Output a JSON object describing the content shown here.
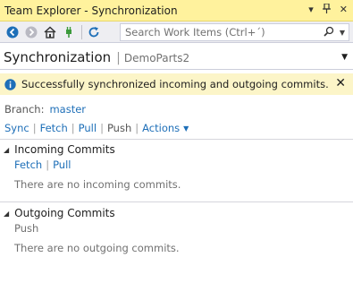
{
  "window": {
    "title": "Team Explorer - Synchronization",
    "controls": [
      "▾",
      "ꟷ",
      "✕"
    ]
  },
  "toolbar": {
    "search_placeholder": "Search Work Items (Ctrl+´)"
  },
  "header": {
    "page_title": "Synchronization",
    "separator": "|",
    "project": "DemoParts2"
  },
  "info": {
    "message": "Successfully synchronized incoming and outgoing commits.",
    "close": "✕"
  },
  "branch": {
    "label": "Branch:",
    "name": "master"
  },
  "actions": {
    "sync": "Sync",
    "fetch": "Fetch",
    "pull": "Pull",
    "push": "Push",
    "more": "Actions"
  },
  "incoming": {
    "title": "Incoming Commits",
    "fetch": "Fetch",
    "pull": "Pull",
    "empty": "There are no incoming commits."
  },
  "outgoing": {
    "title": "Outgoing Commits",
    "push": "Push",
    "empty": "There are no outgoing commits."
  },
  "colors": {
    "title_bg": "#fff29d",
    "info_bg": "#fcf5c8",
    "link": "#1e6fb8",
    "back_btn": "#1e6fb8"
  }
}
